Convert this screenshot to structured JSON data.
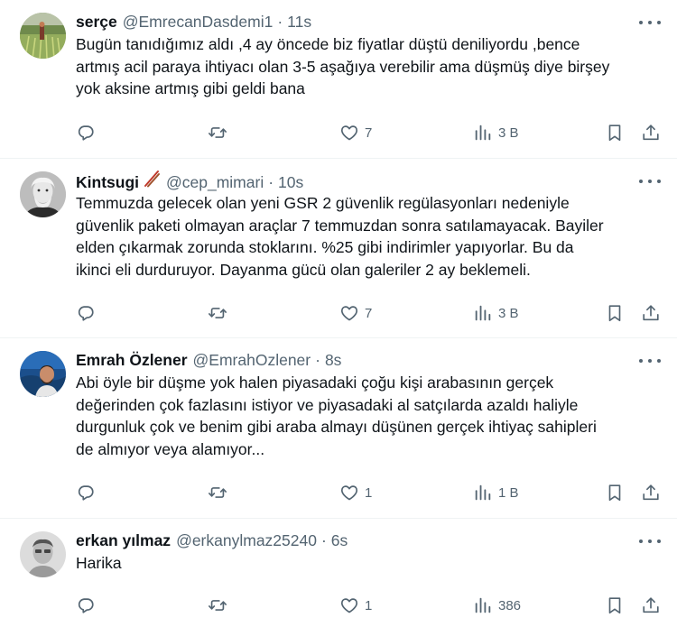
{
  "tweets": [
    {
      "name": "serçe",
      "handle": "@EmrecanDasdemi1",
      "dot": "·",
      "time": "11s",
      "lines": [
        "Bugün tanıdığımız aldı ,4 ay öncede biz fiyatlar düştü deniliyordu ,bence",
        "artmış acil paraya ihtiyacı olan 3-5 aşağıya verebilir ama düşmüş diye birşey",
        "yok aksine artmış gibi geldi bana"
      ],
      "likes": "7",
      "views": "3 B"
    },
    {
      "name": "Kintsugi",
      "name_emoji": "chopsticks-emoji",
      "handle": "@cep_mimari",
      "dot": "·",
      "time": "10s",
      "lines": [
        "Temmuzda gelecek olan yeni GSR 2 güvenlik regülasyonları nedeniyle",
        "güvenlik paketi olmayan araçlar 7 temmuzdan sonra satılamayacak. Bayiler",
        "elden çıkarmak zorunda stoklarını. %25 gibi indirimler yapıyorlar. Bu da",
        "ikinci eli durduruyor. Dayanma gücü olan galeriler 2 ay beklemeli."
      ],
      "likes": "7",
      "views": "3 B"
    },
    {
      "name": "Emrah Özlener",
      "handle": "@EmrahOzlener",
      "dot": "·",
      "time": "8s",
      "lines": [
        "Abi öyle bir düşme yok halen piyasadaki çoğu kişi arabasının gerçek",
        "değerinden çok fazlasını istiyor ve piyasadaki al satçılarda azaldı haliyle",
        "durgunluk çok ve benim gibi araba almayı düşünen gerçek ihtiyaç sahipleri",
        "de almıyor veya alamıyor..."
      ],
      "likes": "1",
      "views": "1 B"
    },
    {
      "name": "erkan yılmaz",
      "handle": "@erkanylmaz25240",
      "dot": "·",
      "time": "6s",
      "lines": [
        "Harika"
      ],
      "likes": "1",
      "views": "386"
    }
  ],
  "colors": {
    "text": "#0f1419",
    "secondary": "#536471",
    "divider": "#eff3f4"
  },
  "icons": [
    "reply-icon",
    "retweet-icon",
    "like-icon",
    "views-icon",
    "bookmark-icon",
    "share-icon",
    "more-icon"
  ]
}
